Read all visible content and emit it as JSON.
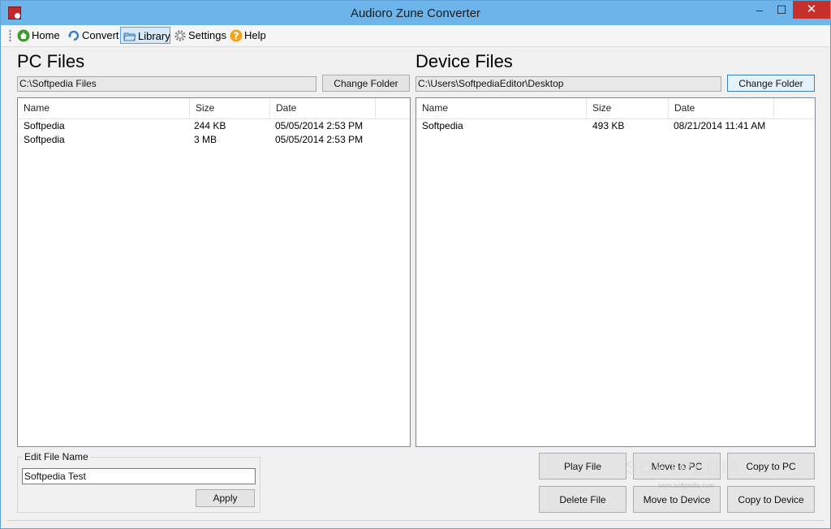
{
  "window": {
    "title": "Audioro Zune Converter",
    "minimize": "–",
    "maximize": "☐",
    "close": "✕"
  },
  "menu": [
    {
      "label": "Home",
      "icon": "home-icon"
    },
    {
      "label": "Convert",
      "icon": "convert-icon"
    },
    {
      "label": "Library",
      "icon": "folder-icon",
      "active": true
    },
    {
      "label": "Settings",
      "icon": "gear-icon"
    },
    {
      "label": "Help",
      "icon": "help-icon"
    }
  ],
  "pc": {
    "title": "PC Files",
    "path": "C:\\Softpedia Files",
    "change_folder": "Change Folder",
    "columns": [
      "Name",
      "Size",
      "Date"
    ],
    "rows": [
      [
        "Softpedia",
        "244 KB",
        "05/05/2014 2:53 PM"
      ],
      [
        "Softpedia",
        "3 MB",
        "05/05/2014 2:53 PM"
      ]
    ]
  },
  "device": {
    "title": "Device Files",
    "path": "C:\\Users\\SoftpediaEditor\\Desktop",
    "change_folder": "Change Folder",
    "columns": [
      "Name",
      "Size",
      "Date"
    ],
    "rows": [
      [
        "Softpedia",
        "493 KB",
        "08/21/2014 11:41 AM"
      ]
    ]
  },
  "edit": {
    "legend": "Edit File Name",
    "value": "Softpedia Test",
    "apply": "Apply"
  },
  "actions": {
    "play": "Play File",
    "move_to_pc": "Move to PC",
    "copy_to_pc": "Copy to PC",
    "delete": "Delete File",
    "move_to_device": "Move to Device",
    "copy_to_device": "Copy to Device"
  },
  "watermark": {
    "main": "SOFTPEDIA",
    "sub": "www.softpedia.com"
  },
  "colors": {
    "titlebar": "#6cb4ea",
    "close": "#c7312b",
    "selection": "#d7e8f7"
  }
}
